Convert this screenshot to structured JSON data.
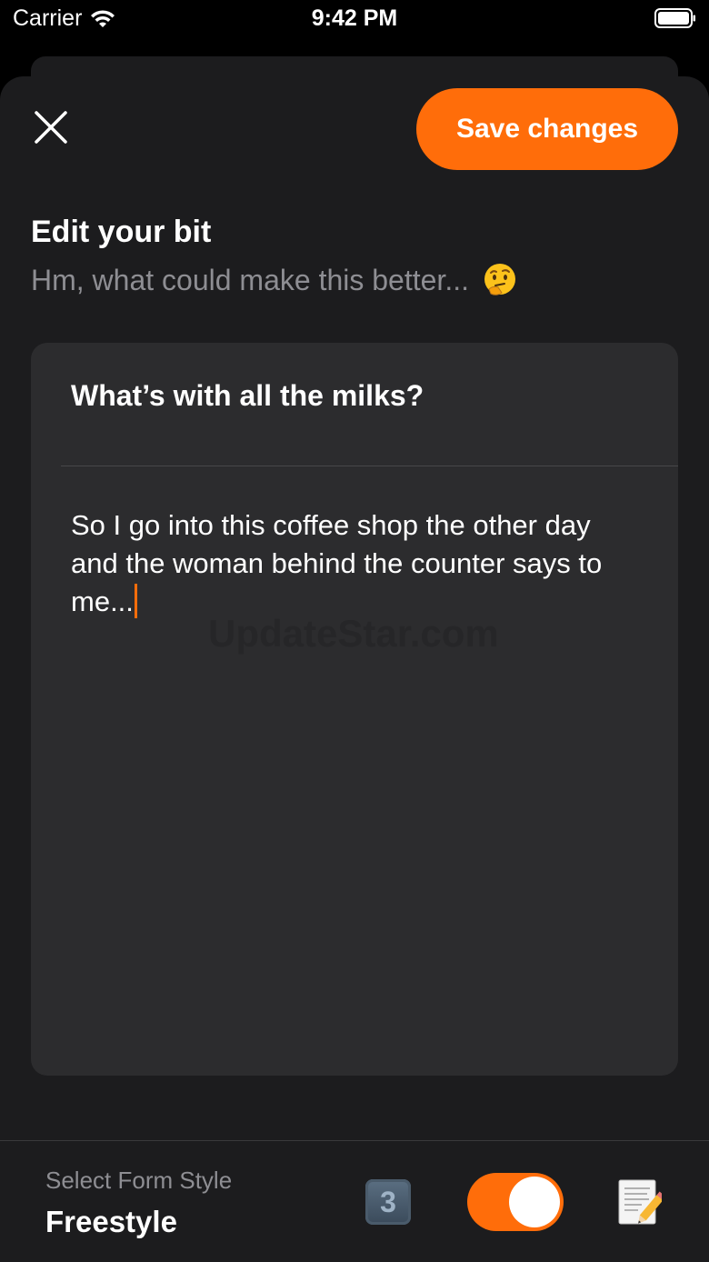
{
  "status_bar": {
    "carrier": "Carrier",
    "time": "9:42 PM"
  },
  "header": {
    "save_label": "Save changes",
    "title": "Edit your bit",
    "subtitle": "Hm, what could make this better..."
  },
  "editor": {
    "bit_title": "What’s with all the milks?",
    "bit_body": "So I go into this coffee shop the other day and the woman behind the counter says to me...",
    "watermark": "UpdateStar.com"
  },
  "toolbar": {
    "form_style_label": "Select Form Style",
    "form_style_value": "Freestyle",
    "keycap_number": "3",
    "toggle_on": true
  },
  "colors": {
    "accent": "#ff6d0a",
    "background": "#000000",
    "sheet": "#1c1c1e",
    "card": "#2c2c2e",
    "secondary_text": "#8e8e93"
  },
  "icons": {
    "close": "close-icon",
    "thinking": "thinking-face-icon",
    "keycap": "keycap-3-icon",
    "memo": "memo-pencil-icon",
    "wifi": "wifi-icon",
    "battery": "battery-icon"
  }
}
